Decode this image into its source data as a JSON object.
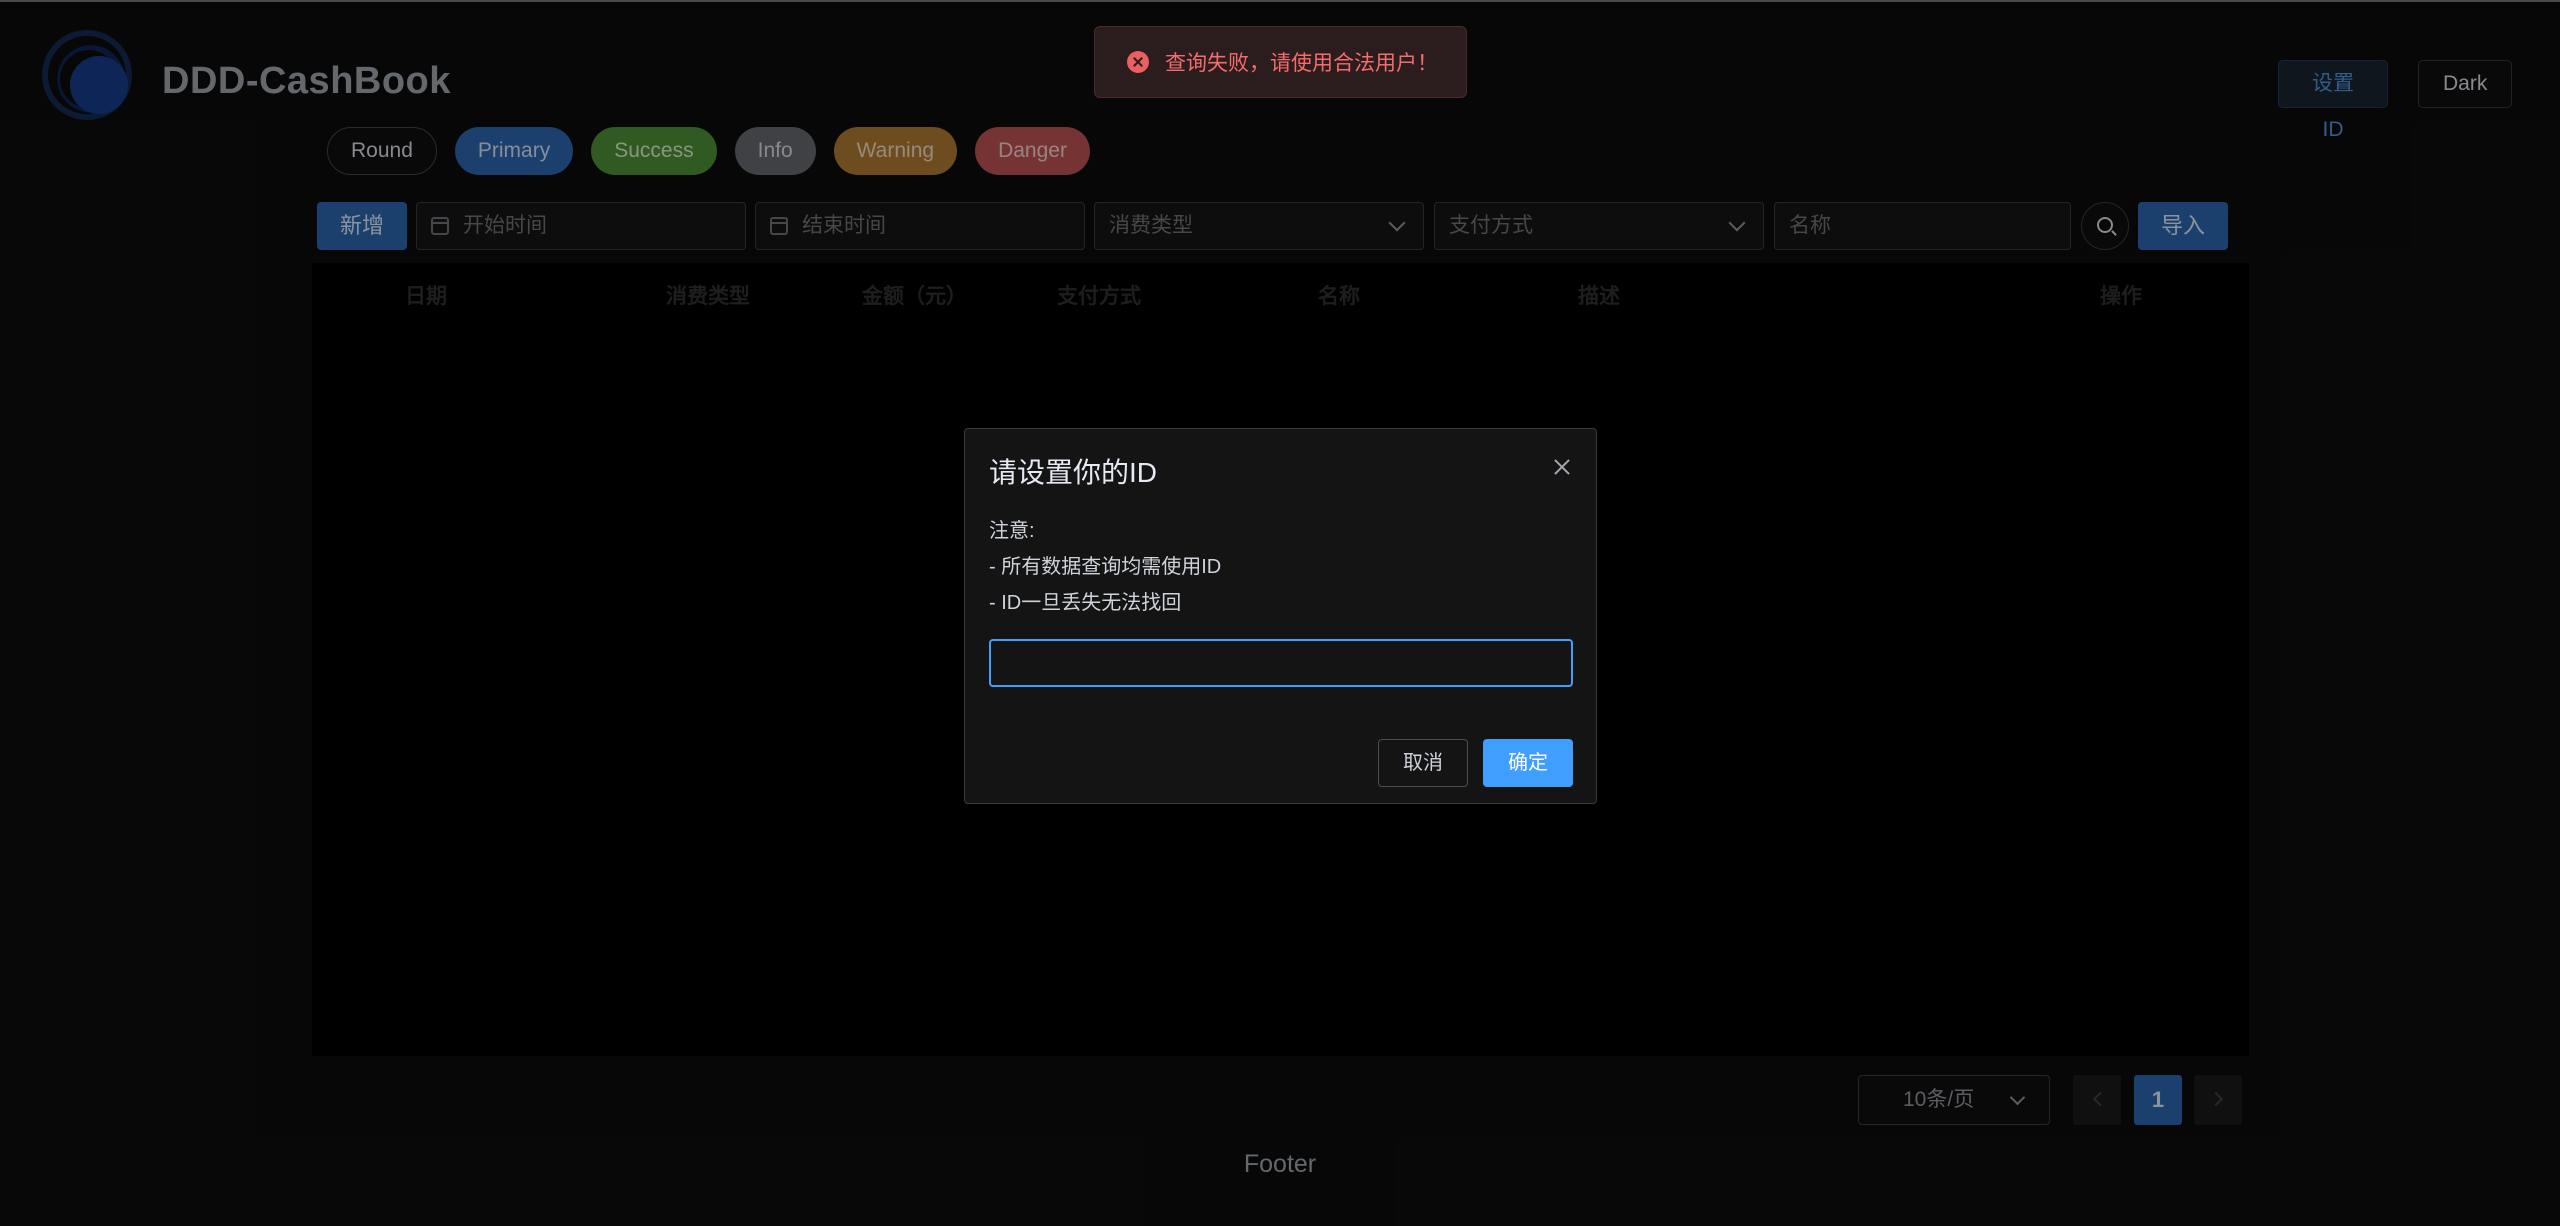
{
  "header": {
    "brand": "DDD-CashBook",
    "set_id_label": "设置ID",
    "dark_label": "Dark"
  },
  "pills": [
    "Round",
    "Primary",
    "Success",
    "Info",
    "Warning",
    "Danger"
  ],
  "toolbar": {
    "add_label": "新增",
    "start_placeholder": "开始时间",
    "end_placeholder": "结束时间",
    "type_placeholder": "消费类型",
    "pay_placeholder": "支付方式",
    "name_placeholder": "名称",
    "import_label": "导入"
  },
  "table": {
    "columns": [
      "日期",
      "消费类型",
      "金额（元）",
      "支付方式",
      "名称",
      "描述",
      "操作"
    ]
  },
  "pagination": {
    "page_size": "10条/页",
    "current_page": "1"
  },
  "footer": "Footer",
  "toast": {
    "message": "查询失败，请使用合法用户！"
  },
  "dialog": {
    "title": "请设置你的ID",
    "note_title": "注意:",
    "note_line1": "- 所有数据查询均需使用ID",
    "note_line2": "- ID一旦丢失无法找回",
    "input_value": "",
    "cancel_label": "取消",
    "ok_label": "确定"
  },
  "colors": {
    "primary": "#409eff",
    "error": "#f56c6c",
    "background": "#0c0c0c"
  }
}
